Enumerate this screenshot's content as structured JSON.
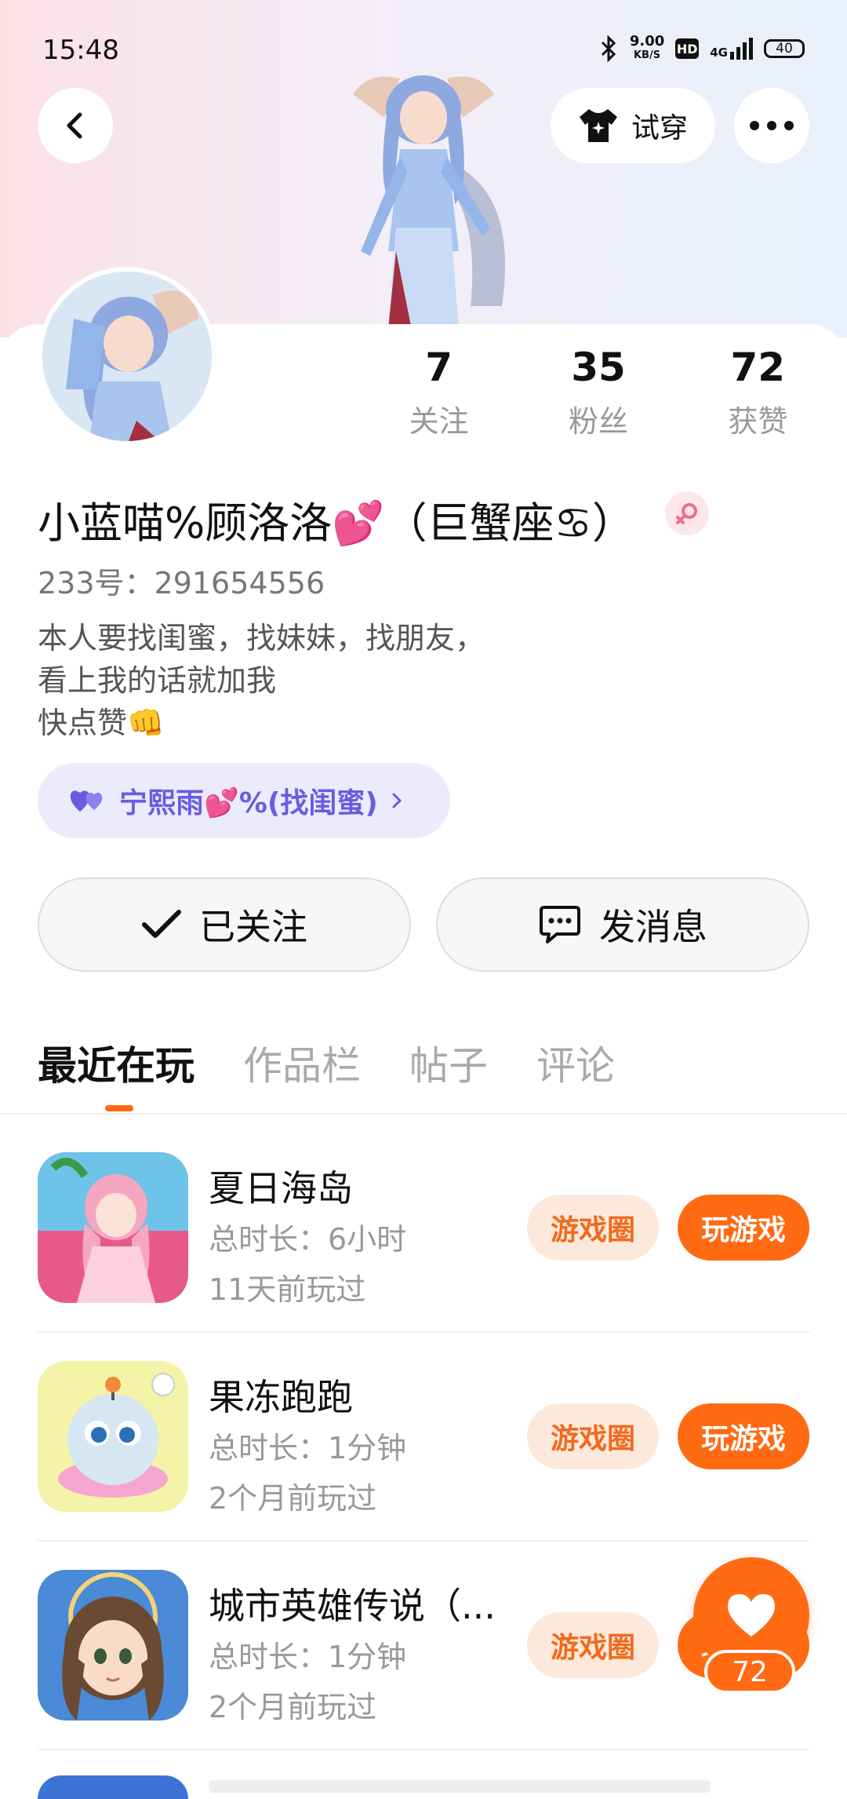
{
  "status_bar": {
    "time": "15:48",
    "net_speed_value": "9.00",
    "net_speed_unit": "KB/S",
    "hd": "HD",
    "signal": "4G",
    "battery": "40"
  },
  "header": {
    "try_on_label": "试穿"
  },
  "stats": [
    {
      "value": "7",
      "label": "关注"
    },
    {
      "value": "35",
      "label": "粉丝"
    },
    {
      "value": "72",
      "label": "获赞"
    }
  ],
  "profile": {
    "nickname": "小蓝喵%顾洛洛💕（巨蟹座♋）",
    "uid": "233号：291654556",
    "bio": "本人要找闺蜜，找妹妹，找朋友，\n看上我的话就加我\n快点赞👊"
  },
  "friend_tag": {
    "label": "宁熙雨💕%(找闺蜜)"
  },
  "actions": {
    "follow_label": "已关注",
    "message_label": "发消息"
  },
  "tabs": [
    "最近在玩",
    "作品栏",
    "帖子",
    "评论"
  ],
  "games": [
    {
      "name": "夏日海岛",
      "duration": "总时长：6小时",
      "last_played": "11天前玩过",
      "circle_label": "游戏圈",
      "play_label": "玩游戏"
    },
    {
      "name": "果冻跑跑",
      "duration": "总时长：1分钟",
      "last_played": "2个月前玩过",
      "circle_label": "游戏圈",
      "play_label": "玩游戏"
    },
    {
      "name": "城市英雄传说（...",
      "duration": "总时长：1分钟",
      "last_played": "2个月前玩过",
      "circle_label": "游戏圈",
      "play_label": "玩游戏"
    }
  ],
  "like_fab": {
    "count": "72"
  },
  "colors": {
    "accent": "#ff6a13",
    "chip_bg": "#fde9dc",
    "tag_bg": "#ecebfc",
    "tag_text": "#6a5ce0"
  }
}
